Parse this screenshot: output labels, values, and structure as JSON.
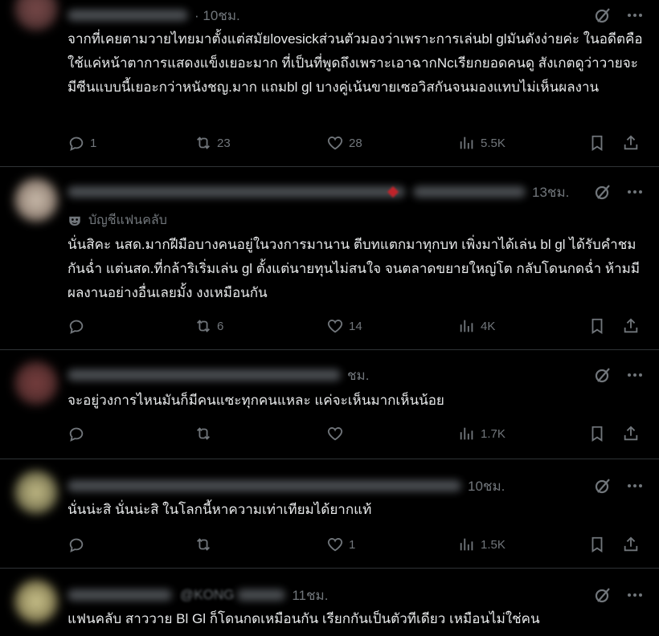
{
  "posts": [
    {
      "time": "· 10ชม.",
      "text": "จากที่เคยตามวายไทยมาตั้งแต่สมัยlovesickส่วนตัวมองว่าเพราะการเล่นbl glมันดังง่ายค่ะ ในอดีตคือใช้แค่หน้าตาการแสดงแข็งเยอะมาก ที่เป็นที่พูดถึงเพราะเอาฉากNcเรียกยอดคนดู สังเกตดูว่าวายจะมีซีนแบบนี้เยอะกว่าหนังชญ.มาก แถมbl gl บางคู่เน้นขายเซอวิสกันจนมองแทบไม่เห็นผลงาน",
      "replies": "1",
      "reposts": "23",
      "likes": "28",
      "views": "5.5K"
    },
    {
      "time": "13ชม.",
      "badge": "บัญชีแฟนคลับ",
      "text": "นั่นสิคะ นสด.มากฝีมือบางคนอยู่ในวงการมานาน ตีบทแตกมาทุกบท เพิ่งมาได้เล่น bl gl ได้รับคำชมกันฉ่ำ แต่นสด.ที่กล้าริเริ่มเล่น gl ตั้งแต่นายทุนไม่สนใจ จนตลาดขยายใหญ่โต กลับโดนกดฉ่ำ ห้ามมีผลงานอย่างอื่นเลยมั้ง งงเหมือนกัน",
      "replies": "",
      "reposts": "6",
      "likes": "14",
      "views": "4K"
    },
    {
      "time": "ชม.",
      "text": "จะอยู่วงการไหนมันก็มีคนแซะทุกคนแหละ แค่จะเห็นมากเห็นน้อย",
      "replies": "",
      "reposts": "",
      "likes": "",
      "views": "1.7K"
    },
    {
      "time": "10ชม.",
      "text": "นั่นน่ะสิ นั่นน่ะสิ ในโลกนี้หาความเท่าเทียมได้ยากแท้",
      "replies": "",
      "reposts": "",
      "likes": "1",
      "views": "1.5K"
    },
    {
      "handle": "@KONG",
      "time": "11ชม.",
      "text": "แฟนคลับ สาววาย Bl Gl ก็โดนกดเหมือนกัน เรียกกันเป็นตัวทีเดียว เหมือนไม่ใช่คน"
    }
  ],
  "colors": {
    "bg": "#000000",
    "text": "#e7e9ea",
    "muted": "#71767b",
    "divider": "#2f3336"
  },
  "icons": [
    "grok-slash-icon",
    "more-icon",
    "reply-icon",
    "repost-icon",
    "like-icon",
    "views-icon",
    "bookmark-icon",
    "share-icon",
    "mask-icon"
  ]
}
